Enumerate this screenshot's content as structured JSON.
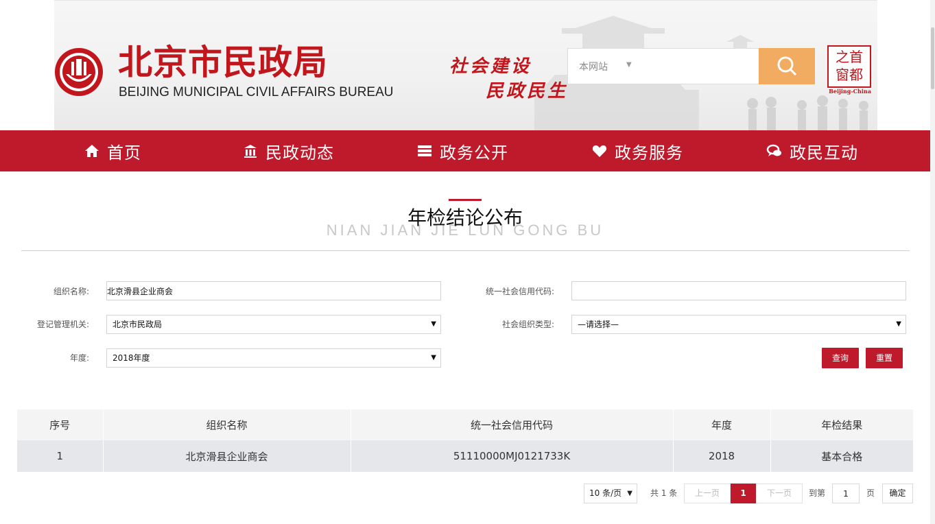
{
  "header": {
    "title_cn": "北京市民政局",
    "title_en": "BEIJING MUNICIPAL CIVIL AFFAIRS BUREAU",
    "slogan_line1": "社会建设",
    "slogan_line2": "民政民生",
    "search": {
      "scope": "本网站",
      "placeholder": ""
    },
    "capital_logo": {
      "line1": "之首",
      "line2": "窗都",
      "caption": "Beijing-China"
    },
    "brand_color": "#c0161c"
  },
  "nav": {
    "color": "#bf1a2c",
    "items": [
      {
        "label": "首页",
        "icon": "home-icon"
      },
      {
        "label": "民政动态",
        "icon": "building-icon"
      },
      {
        "label": "政务公开",
        "icon": "list-icon"
      },
      {
        "label": "政务服务",
        "icon": "heart-icon"
      },
      {
        "label": "政民互动",
        "icon": "chat-icon"
      }
    ]
  },
  "section": {
    "title": "年检结论公布",
    "subtitle": "NIAN JIAN JIE LUN GONG BU"
  },
  "form": {
    "org_name_label": "组织名称:",
    "org_name_value": "北京滑县企业商会",
    "credit_code_label": "统一社会信用代码:",
    "credit_code_value": "",
    "authority_label": "登记管理机关:",
    "authority_value": "北京市民政局",
    "org_type_label": "社会组织类型:",
    "org_type_value": "—请选择—",
    "year_label": "年度:",
    "year_value": "2018年度",
    "query_label": "查询",
    "reset_label": "重置"
  },
  "table": {
    "columns": [
      "序号",
      "组织名称",
      "统一社会信用代码",
      "年度",
      "年检结果"
    ],
    "rows": [
      [
        "1",
        "北京滑县企业商会",
        "51110000MJ0121733K",
        "2018",
        "基本合格"
      ]
    ]
  },
  "pager": {
    "page_size": "10 条/页",
    "total": "共 1 条",
    "prev": "上一页",
    "current": "1",
    "next": "下一页",
    "goto_label": "到第",
    "goto_value": "1",
    "page_unit": "页",
    "confirm": "确定"
  }
}
